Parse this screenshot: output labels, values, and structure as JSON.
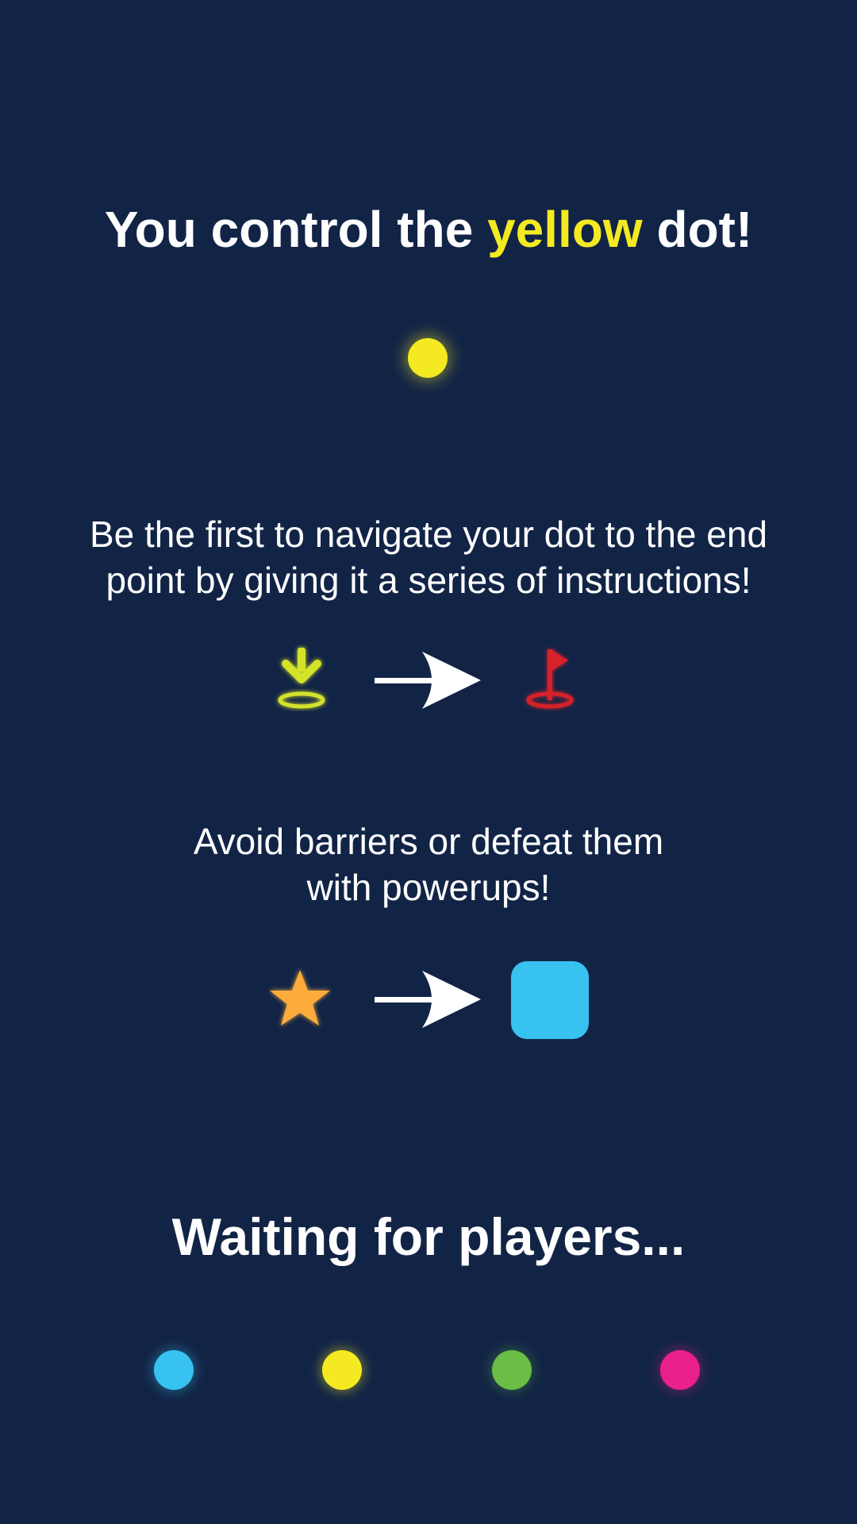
{
  "intro": {
    "title_before": "You control the ",
    "title_highlight": "yellow",
    "title_after": " dot!",
    "highlight_color": "#f5ea22"
  },
  "navigate_text": {
    "line1": "Be the first to navigate your dot to the end",
    "line2": "point by giving it a series of instructions!"
  },
  "navigate_icons": [
    "start-point-icon",
    "arrow-right-icon",
    "finish-flag-icon"
  ],
  "barrier_text": {
    "line1": "Avoid barriers or defeat them",
    "line2": "with powerups!"
  },
  "barrier_icons": [
    "star-powerup-icon",
    "arrow-right-icon",
    "barrier-block-icon"
  ],
  "waiting": {
    "label": "Waiting for players..."
  },
  "players": [
    {
      "color": "#38c2f1"
    },
    {
      "color": "#f5ea22"
    },
    {
      "color": "#6abd45"
    },
    {
      "color": "#ea1f8e"
    }
  ],
  "colors": {
    "background": "#122446",
    "yellow": "#f5ea22",
    "red": "#d6232a",
    "orange": "#fbac3a",
    "blue": "#38c2f1",
    "green": "#6abd45",
    "pink": "#ea1f8e"
  }
}
